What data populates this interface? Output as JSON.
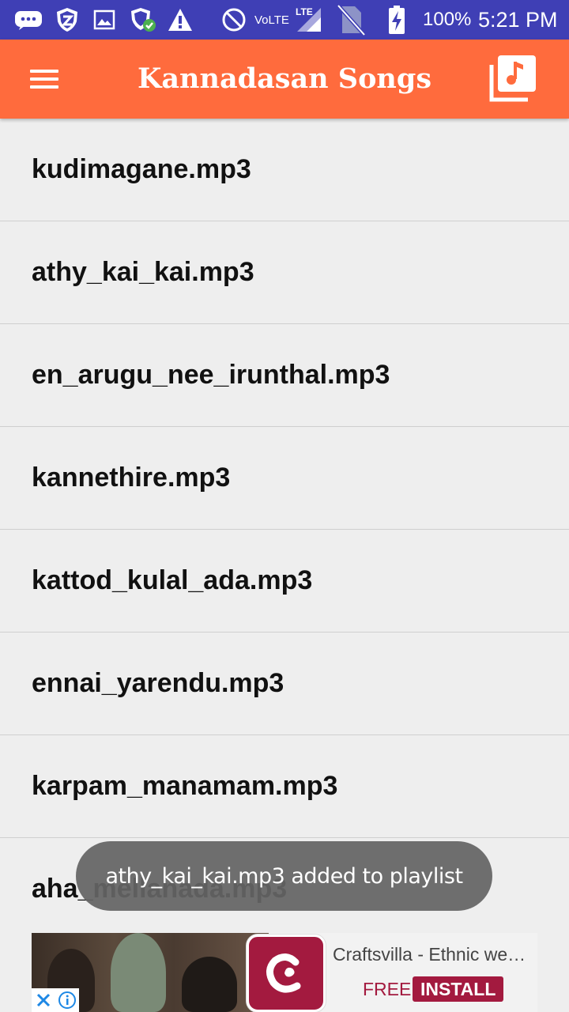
{
  "status_bar": {
    "network_label": "VoLTE",
    "battery_percent": "100%",
    "time": "5:21 PM",
    "icons": [
      "messages-icon",
      "shield-icon",
      "gallery-icon",
      "security-check-icon",
      "warning-icon",
      "do-not-disturb-icon",
      "lte-signal-icon",
      "no-sim-icon",
      "battery-charging-icon"
    ]
  },
  "toolbar": {
    "title": "Kannadasan Songs",
    "menu_icon": "hamburger-menu-icon",
    "playlist_icon": "music-library-icon",
    "background_color": "#ff6b3d"
  },
  "songs": [
    {
      "label": "kudimagane.mp3"
    },
    {
      "label": "athy_kai_kai.mp3"
    },
    {
      "label": "en_arugu_nee_irunthal.mp3"
    },
    {
      "label": "kannethire.mp3"
    },
    {
      "label": "kattod_kulal_ada.mp3"
    },
    {
      "label": "ennai_yarendu.mp3"
    },
    {
      "label": "karpam_manamam.mp3"
    },
    {
      "label": "aha_mellanada.mp3"
    }
  ],
  "toast": {
    "message": "athy_kai_kai.mp3 added to playlist"
  },
  "ad": {
    "app_name": "Craftsvilla - Ethnic we…",
    "free_label": "FREE",
    "install_label": "INSTALL",
    "brand_color": "#a31a3f"
  }
}
